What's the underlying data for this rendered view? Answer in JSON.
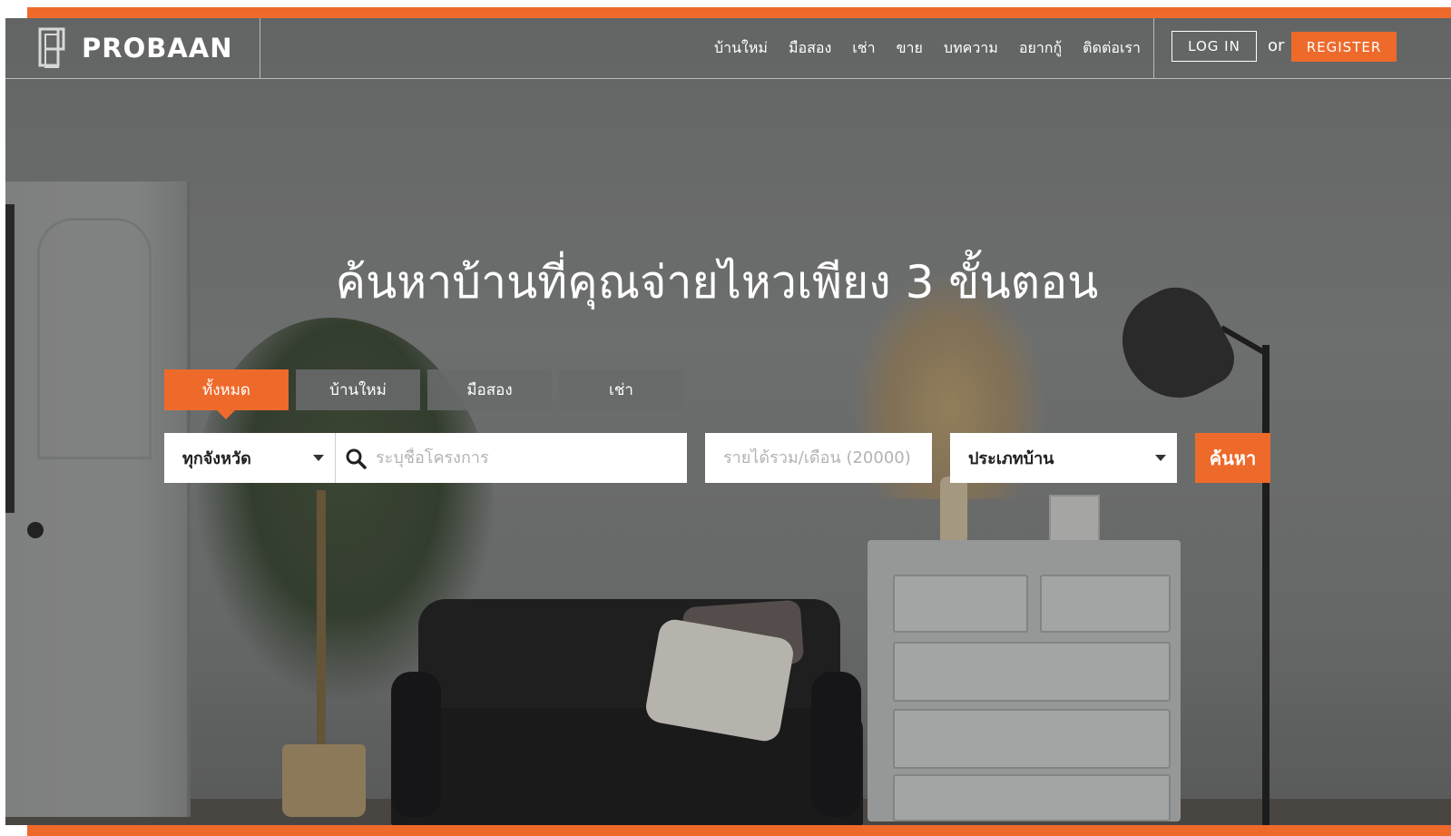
{
  "brand": {
    "name": "PROBAAN",
    "icon": "probaan-logo-icon"
  },
  "nav": {
    "links": [
      "บ้านใหม่",
      "มือสอง",
      "เช่า",
      "ขาย",
      "บทความ",
      "อยากกู้",
      "ติดต่อเรา"
    ],
    "login_label": "LOG IN",
    "or_label": "or",
    "register_label": "REGISTER"
  },
  "hero": {
    "headline": "ค้นหาบ้านที่คุณจ่ายไหวเพียง 3 ขั้นตอน",
    "tabs": [
      "ทั้งหมด",
      "บ้านใหม่",
      "มือสอง",
      "เช่า"
    ],
    "active_tab": "ทั้งหมด"
  },
  "search": {
    "province_value": "ทุกจังหวัด",
    "project_placeholder": "ระบุชื่อโครงการ",
    "income_placeholder": "รายได้รวม/เดือน (20000)",
    "type_value": "ประเภทบ้าน",
    "submit_label": "ค้นหา",
    "icon": "search-icon"
  },
  "colors": {
    "accent": "#ee6a2b",
    "navbar_text": "#ffffff",
    "input_bg": "#ffffff"
  }
}
